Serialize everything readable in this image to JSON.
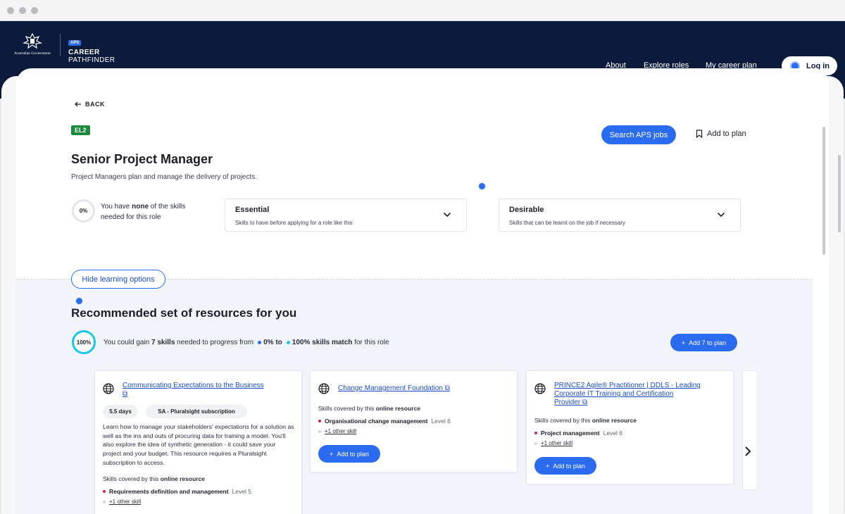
{
  "header": {
    "gov_label": "Australian Government",
    "badge": "APS",
    "brand_line1": "CAREER",
    "brand_line2": "PATHFINDER",
    "nav": [
      "About",
      "Explore roles",
      "My career plan"
    ],
    "login": "Log in"
  },
  "role": {
    "back": "BACK",
    "level": "EL2",
    "search_jobs": "Search APS jobs",
    "add_to_plan": "Add to plan",
    "title": "Senior Project Manager",
    "subtitle": "Project Managers plan and manage the delivery of projects.",
    "skill_percent": "0%",
    "skill_text_pre": "You have ",
    "skill_text_bold": "none",
    "skill_text_post": " of the skills needed for this role",
    "essential_title": "Essential",
    "essential_sub": "Skills to have before applying for a role like this",
    "desirable_title": "Desirable",
    "desirable_sub": "Skills that can be learnt on the job if necessary"
  },
  "resources": {
    "hide_btn": "Hide learning options",
    "heading": "Recommended set of resources for you",
    "percent": "100%",
    "gain_pre": "You could gain ",
    "gain_bold": "7 skills",
    "gain_mid": " needed to progress from ",
    "from_bold": "0% to",
    "to_bold": "100% skills match",
    "gain_post": " for this role",
    "add_all": "Add 7 to plan",
    "colors": {
      "accent": "#2b6bf0",
      "skill_dot": "#c7254e",
      "ring": "#18c6e8"
    },
    "cards": [
      {
        "title": "Communicating Expectations to the Business",
        "duration": "5.5 days",
        "subscription": "SA - Pluralsight subscription",
        "description": "Learn how to manage your stakeholders' expectations for a solution as well as the ins and outs of procuring data for training a model. You'll also explore the idea of synthetic generation - it could save your project and your budget. This resource requires a Pluralsight subscription to access.",
        "covered_pre": "Skills covered by this ",
        "covered_bold": "online resource",
        "skill": "Requirements definition and management",
        "level": "Level 5",
        "other": "+1 other skill"
      },
      {
        "title": "Change Management Foundation",
        "covered_pre": "Skills covered by this ",
        "covered_bold": "online resource",
        "skill": "Organisational change management",
        "level": "Level 6",
        "other": "+1 other skill",
        "button": "Add to plan"
      },
      {
        "title_line1": "PRINCE2 Agile® Practitioner | DDLS - Leading",
        "title_line2": "Corporate IT Training and Certification",
        "title_line3": "Provider",
        "covered_pre": "Skills covered by this ",
        "covered_bold": "online resource",
        "skill": "Project management",
        "level": "Level 6",
        "other": "+1 other skill",
        "button": "Add to plan"
      }
    ]
  }
}
